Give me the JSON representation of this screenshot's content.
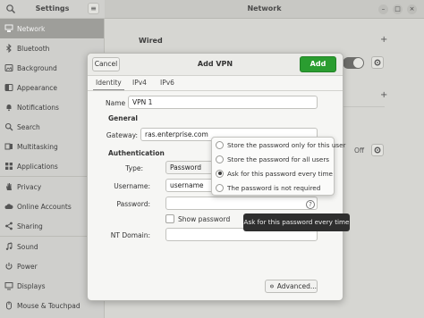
{
  "settings_header": {
    "title": "Settings",
    "menu_icon": "hamburger-icon",
    "search_icon": "search-icon"
  },
  "network_header": {
    "title": "Network",
    "window_controls": [
      "minimize-icon",
      "maximize-icon",
      "close-icon"
    ]
  },
  "sidebar": {
    "items": [
      {
        "label": "Network",
        "icon": "network-icon",
        "active": true
      },
      {
        "label": "Bluetooth",
        "icon": "bluetooth-icon"
      },
      {
        "label": "Background",
        "icon": "background-icon"
      },
      {
        "label": "Appearance",
        "icon": "appearance-icon"
      },
      {
        "label": "Notifications",
        "icon": "bell-icon"
      },
      {
        "label": "Search",
        "icon": "search-icon"
      },
      {
        "label": "Multitasking",
        "icon": "multitasking-icon"
      },
      {
        "label": "Applications",
        "icon": "applications-icon"
      },
      {
        "label": "Privacy",
        "icon": "hand-icon"
      },
      {
        "label": "Online Accounts",
        "icon": "cloud-icon"
      },
      {
        "label": "Sharing",
        "icon": "share-icon"
      },
      {
        "label": "Sound",
        "icon": "music-icon"
      },
      {
        "label": "Power",
        "icon": "power-icon"
      },
      {
        "label": "Displays",
        "icon": "display-icon"
      },
      {
        "label": "Mouse & Touchpad",
        "icon": "mouse-icon"
      }
    ]
  },
  "main": {
    "wired_title": "Wired",
    "off_label": "Off"
  },
  "dialog": {
    "cancel_label": "Cancel",
    "title": "Add VPN",
    "add_label": "Add",
    "tabs": [
      {
        "label": "Identity",
        "active": true
      },
      {
        "label": "IPv4"
      },
      {
        "label": "IPv6"
      }
    ],
    "name_label": "Name",
    "name_value": "VPN 1",
    "general_section": "General",
    "gateway_label": "Gateway:",
    "gateway_value": "ras.enterprise.com",
    "authentication_section": "Authentication",
    "type_label": "Type:",
    "type_value": "Password",
    "username_label": "Username:",
    "username_value": "username",
    "password_label": "Password:",
    "password_value": "",
    "show_password_label": "Show password",
    "show_password_checked": false,
    "nt_domain_label": "NT Domain:",
    "nt_domain_value": "",
    "advanced_label": "Advanced..."
  },
  "password_popover": {
    "options": [
      {
        "label": "Store the password only for this user",
        "checked": false
      },
      {
        "label": "Store the password for all users",
        "checked": false
      },
      {
        "label": "Ask for this password every time",
        "checked": true
      },
      {
        "label": "The password is not required",
        "checked": false
      }
    ]
  },
  "tooltip": {
    "text": "Ask for this password every time"
  },
  "colors": {
    "accent_green": "#2a9d30",
    "sidebar_active": "#9e9e9a",
    "tooltip_bg": "#2e2e2e"
  }
}
